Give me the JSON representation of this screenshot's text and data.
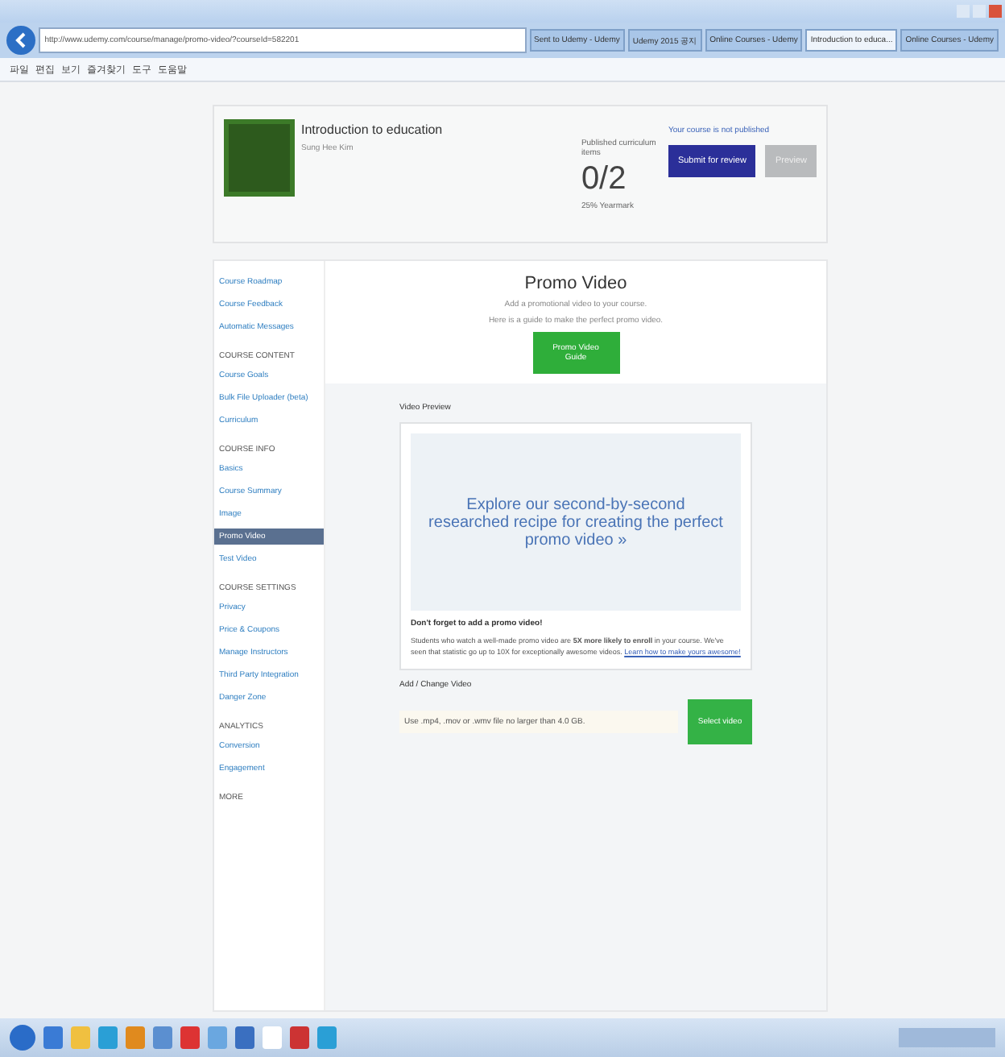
{
  "browser": {
    "address": "http://www.udemy.com/course/manage/promo-video/?courseId=582201",
    "tabs": [
      {
        "label": "Sent to Udemy - Udemy",
        "selected": false
      },
      {
        "label": "Udemy 2015 공지",
        "selected": false
      },
      {
        "label": "Online Courses - Udemy",
        "selected": false
      },
      {
        "label": "Introduction to educa...",
        "selected": true
      },
      {
        "label": "Online Courses - Udemy",
        "selected": false
      }
    ],
    "menu": [
      "파일",
      "편집",
      "보기",
      "즐겨찾기",
      "도구",
      "도움말"
    ]
  },
  "course": {
    "title": "Introduction to education",
    "author": "Sung Hee Kim",
    "stats_label": "Published curriculum items",
    "count": "0/2",
    "stats_note": "25% Yearmark",
    "notice": "Your course is not published",
    "buttons": [
      {
        "label": "Submit for review",
        "kind": "primary"
      },
      {
        "label": "Preview",
        "kind": "disabled"
      }
    ]
  },
  "sidebar": [
    {
      "items": [
        {
          "label": "Course Roadmap",
          "selected": false
        },
        {
          "label": "Course Feedback",
          "selected": false
        },
        {
          "label": "Automatic Messages",
          "selected": false
        }
      ]
    },
    {
      "heading": "COURSE CONTENT",
      "items": [
        {
          "label": "Course Goals",
          "selected": false
        },
        {
          "label": "Bulk File Uploader (beta)",
          "selected": false
        },
        {
          "label": "Curriculum",
          "selected": false
        }
      ]
    },
    {
      "heading": "COURSE INFO",
      "items": [
        {
          "label": "Basics",
          "selected": false
        },
        {
          "label": "Course Summary",
          "selected": false
        },
        {
          "label": "Image",
          "selected": false
        },
        {
          "label": "Promo Video",
          "selected": true
        },
        {
          "label": "Test Video",
          "selected": false
        }
      ]
    },
    {
      "heading": "COURSE SETTINGS",
      "items": [
        {
          "label": "Privacy",
          "selected": false
        },
        {
          "label": "Price & Coupons",
          "selected": false
        },
        {
          "label": "Manage Instructors",
          "selected": false
        },
        {
          "label": "Third Party Integration",
          "selected": false
        },
        {
          "label": "Danger Zone",
          "selected": false
        }
      ]
    },
    {
      "heading": "ANALYTICS",
      "items": [
        {
          "label": "Conversion",
          "selected": false
        },
        {
          "label": "Engagement",
          "selected": false
        }
      ]
    },
    {
      "heading": "MORE"
    }
  ],
  "promo": {
    "title": "Promo Video",
    "lines": [
      "Add a promotional video to your course.",
      "Here is a guide to make the perfect promo video."
    ],
    "guide_button": "Promo Video Guide",
    "preview_label": "Video Preview",
    "preview_text": "Explore our second-by-second researched recipe for creating the perfect promo video »",
    "tip_title": "Don't forget to add a promo video!",
    "tip_text": "Students who watch a well-made promo video are **5X more likely to enroll** in your course. We've seen that statistic go up to 10X for exceptionally awesome videos.",
    "tip_link": "Learn how to make yours awesome!",
    "upload_label": "Add / Change Video",
    "upload_placeholder": "Use .mp4, .mov or .wmv file no larger than 4.0 GB.",
    "upload_button": "Select video"
  }
}
